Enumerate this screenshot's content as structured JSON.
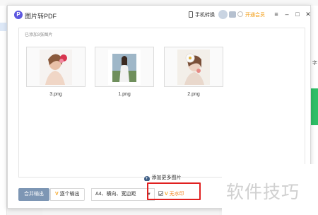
{
  "window": {
    "title": "图片转PDF",
    "logo_letter": "P",
    "phone_convert": "手机转换",
    "vip_label": "开通会员",
    "menu_glyph": "≡",
    "min_glyph": "–",
    "max_glyph": "□",
    "close_glyph": "✕"
  },
  "panel": {
    "added_label": "已添加3张图片",
    "images": [
      {
        "filename": "3.png"
      },
      {
        "filename": "1.png"
      },
      {
        "filename": "2.png"
      }
    ],
    "add_more_icon": "+",
    "add_more_label": "添加更多图片"
  },
  "footer": {
    "merge_label": "合并输出",
    "single_vip_mark": "V",
    "single_label": "逐个输出",
    "page_setting": "A4、横向、宽边距",
    "dropdown_glyph": "▼",
    "nowm_vip_mark": "V",
    "nowm_label": "无水印"
  },
  "watermark": "软件技巧",
  "background": {
    "right_char": "字"
  },
  "colors": {
    "accent_logo": "#5d58e0",
    "merge_button": "#7d96b4",
    "vip_orange": "#f39c12",
    "highlight": "#e02020",
    "bg_green": "#2fbe67"
  }
}
